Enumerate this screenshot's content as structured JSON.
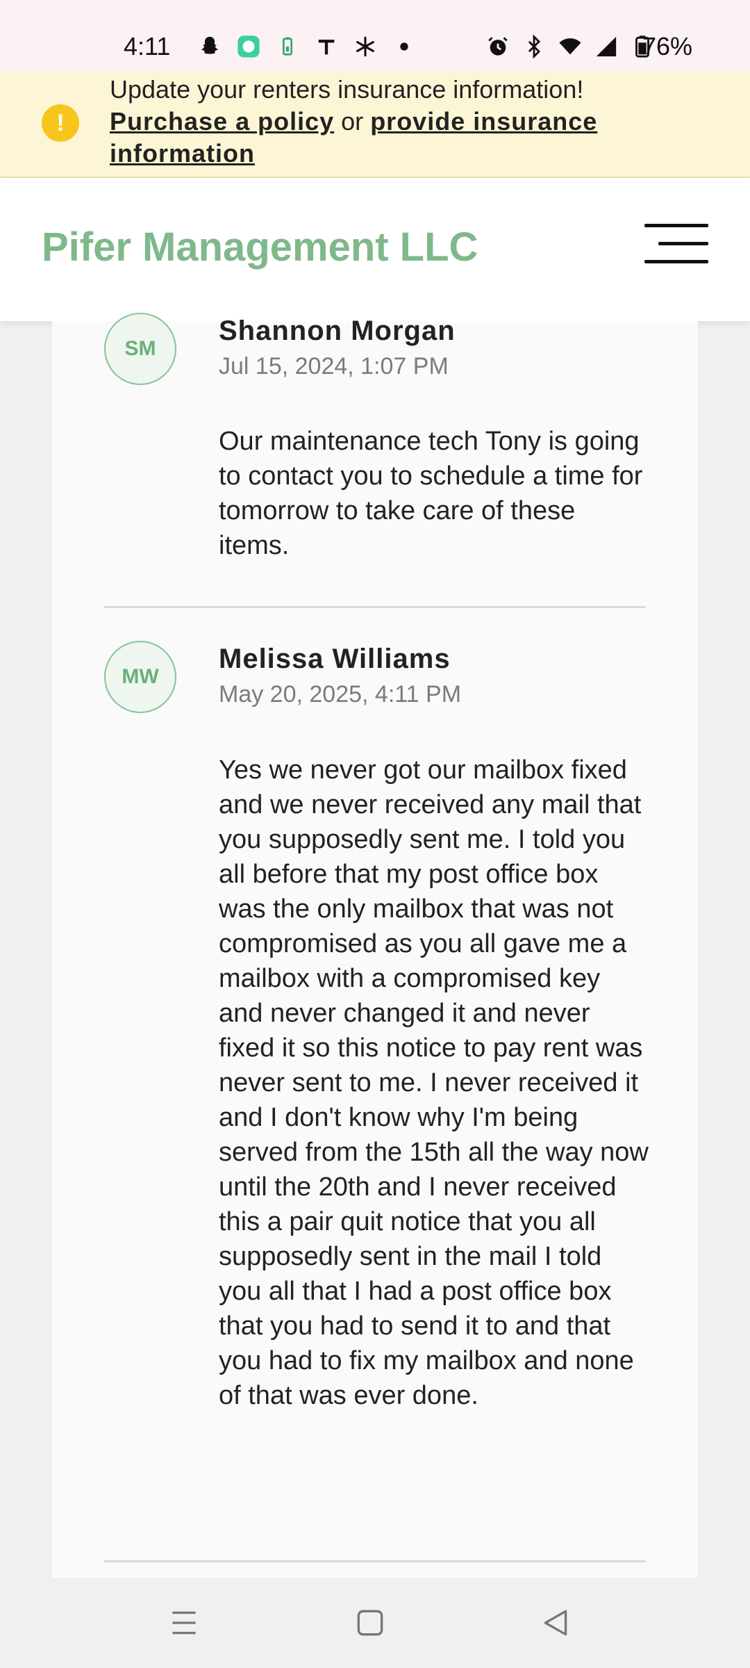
{
  "status_bar": {
    "time": "4:11",
    "battery": "76%",
    "left_icons": [
      "snapchat-icon",
      "chat-app-icon",
      "battery-saver-icon",
      "t-app-icon",
      "pinwheel-icon",
      "dot-icon"
    ],
    "right_icons": [
      "alarm-icon",
      "bluetooth-icon",
      "wifi-icon",
      "signal-icon",
      "battery-icon"
    ]
  },
  "banner": {
    "title": "Update your renters insurance information!",
    "link_purchase": "Purchase a policy",
    "or_text": "or",
    "link_provide": "provide insurance information",
    "icon": "!",
    "color": "#f7c51c"
  },
  "header": {
    "brand": "Pifer Management LLC",
    "brand_color": "#7fb88a"
  },
  "messages": [
    {
      "initials": "SM",
      "author": "Shannon Morgan",
      "date": "Jul 15, 2024, 1:07 PM",
      "body": "Our maintenance tech Tony is going to contact you to schedule a time for tomorrow to take care of these items."
    },
    {
      "initials": "MW",
      "author": "Melissa Williams",
      "date": "May 20, 2025, 4:11 PM",
      "body": "Yes we never got our mailbox fixed and we never received any mail that you supposedly sent me. I told you all before that my post office box was the only mailbox that was not compromised as you all gave me a mailbox with a compromised key and never changed it and never fixed it so this notice to pay rent was never sent to me. I never received it and I don't know why I'm being served from the 15th all the way now until the 20th and I never received this a pair quit notice that you all supposedly sent in the mail I told you all that I had a post office box that you had to send it to and that you had to fix my mailbox and none of that was ever done."
    }
  ],
  "nav_bar": {
    "icons": [
      "recents-icon",
      "home-icon",
      "back-icon"
    ]
  }
}
